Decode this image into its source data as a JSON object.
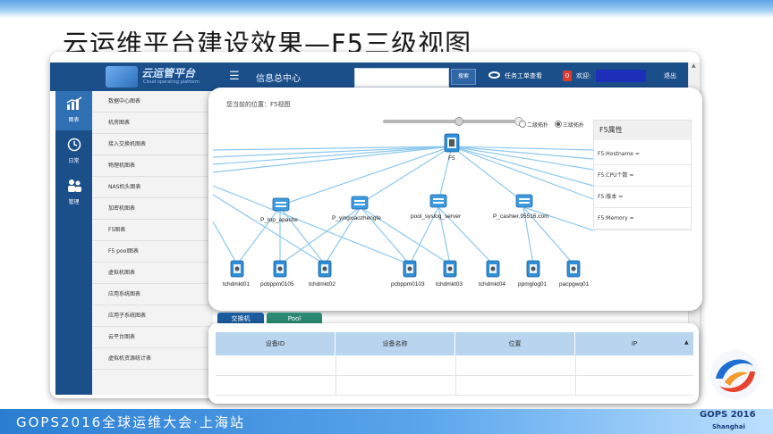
{
  "slide": {
    "title": "云运维平台建设效果—F5三级视图",
    "conference": "GOPS2016全球运维大会·上海站",
    "brand": "GOPS 2016",
    "brand_city": "Shanghai"
  },
  "header": {
    "logo_title": "云运管平台",
    "logo_subtitle": "Cloud operating platform",
    "section": "信息总中心",
    "search_placeholder": "",
    "search_button": "搜索",
    "task_label": "任务工单查看",
    "badge_count": "0",
    "welcome": "欢迎:",
    "logout": "退出"
  },
  "side_nav": [
    {
      "label": "图表",
      "icon": "bar-chart-icon"
    },
    {
      "label": "日常",
      "icon": "clock-icon"
    },
    {
      "label": "管理",
      "icon": "users-icon"
    }
  ],
  "side_menu": [
    "数据中心图表",
    "机房图表",
    "接入交换机图表",
    "物理机图表",
    "NAS机头图表",
    "加密机图表",
    "F5图表",
    "F5 pool图表",
    "虚拟机图表",
    "应用系统图表",
    "应用子系统图表",
    "云平台图表",
    "虚拟机资源统计表"
  ],
  "view": {
    "breadcrumb": "您当前的位置：F5视图",
    "radio_two": "二级拓扑",
    "radio_three": "三级拓扑",
    "root_node": "F5",
    "pools": [
      "P_top_apache",
      "P_yingxiaozhengfe",
      "pool_syslog_server",
      "P_cashier.95516.com"
    ],
    "hosts": [
      "tchdmkt01",
      "pcbppm0105",
      "tchdmkt02",
      "pcbppm0103",
      "tchdmkt03",
      "tchdmkt04",
      "ppmglog01",
      "pacpgwq01"
    ]
  },
  "properties": {
    "title": "F5属性",
    "rows": [
      "F5:Hostname =",
      "F5:CPU个数 =",
      "F5:版本 =",
      "F5:Memory ="
    ]
  },
  "lower": {
    "tabs": [
      "交换机",
      "Pool"
    ],
    "columns": [
      "设备ID",
      "设备名称",
      "位置",
      "IP"
    ]
  },
  "colors": {
    "nav_blue": "#1b4f8a",
    "link_blue": "#8cc8ee",
    "node_blue": "#2e8fd8",
    "table_header": "#b9d4ee"
  }
}
